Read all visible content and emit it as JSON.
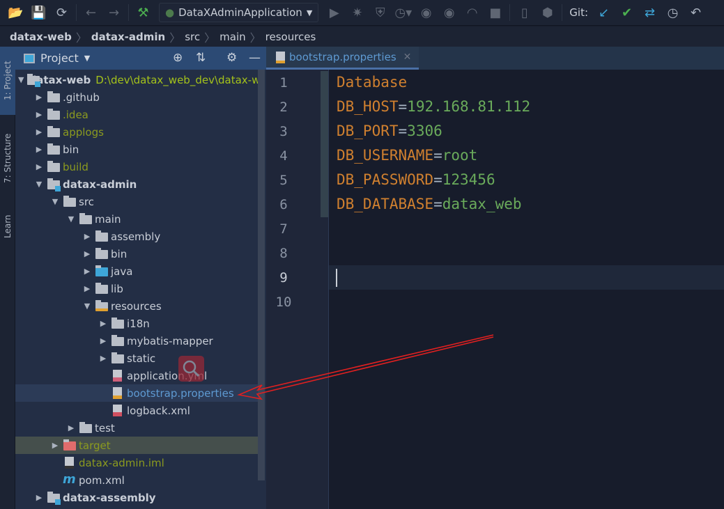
{
  "toolbar": {
    "run_config": "DataXAdminApplication",
    "git_label": "Git:",
    "icons": [
      "open-folder",
      "save",
      "sync",
      "back",
      "forward",
      "build-hammer",
      "run",
      "debug",
      "coverage",
      "profile",
      "attach",
      "attach-debug",
      "profiler",
      "stop",
      "device",
      "sdk",
      "git-update",
      "git-commit",
      "git-merge",
      "git-history",
      "rollback"
    ],
    "colors": {
      "hammer": "#4caf50",
      "git_update": "#3ea6d8",
      "git_commit": "#4caf50"
    }
  },
  "breadcrumb": [
    "datax-web",
    "datax-admin",
    "src",
    "main",
    "resources"
  ],
  "side_tabs": {
    "project": "1: Project",
    "structure": "7: Structure",
    "learn": "Learn"
  },
  "project_panel": {
    "title": "Project",
    "tree": [
      {
        "label": "datax-web",
        "path": "D:\\dev\\datax_web_dev\\datax-w",
        "level": 0,
        "open": true,
        "type": "module",
        "bold": true
      },
      {
        "label": ".github",
        "level": 1,
        "open": false,
        "type": "folder"
      },
      {
        "label": ".idea",
        "level": 1,
        "open": false,
        "type": "folder",
        "color": "#8b9a1f"
      },
      {
        "label": "applogs",
        "level": 1,
        "open": false,
        "type": "folder",
        "color": "#8b9a1f"
      },
      {
        "label": "bin",
        "level": 1,
        "open": false,
        "type": "folder"
      },
      {
        "label": "build",
        "level": 1,
        "open": false,
        "type": "folder",
        "color": "#8b9a1f"
      },
      {
        "label": "datax-admin",
        "level": 1,
        "open": true,
        "type": "module",
        "bold": true
      },
      {
        "label": "src",
        "level": 2,
        "open": true,
        "type": "folder"
      },
      {
        "label": "main",
        "level": 3,
        "open": true,
        "type": "folder"
      },
      {
        "label": "assembly",
        "level": 4,
        "open": false,
        "type": "folder"
      },
      {
        "label": "bin",
        "level": 4,
        "open": false,
        "type": "folder"
      },
      {
        "label": "java",
        "level": 4,
        "open": false,
        "type": "source-folder"
      },
      {
        "label": "lib",
        "level": 4,
        "open": false,
        "type": "folder"
      },
      {
        "label": "resources",
        "level": 4,
        "open": true,
        "type": "resources-folder"
      },
      {
        "label": "i18n",
        "level": 5,
        "open": false,
        "type": "folder"
      },
      {
        "label": "mybatis-mapper",
        "level": 5,
        "open": false,
        "type": "folder"
      },
      {
        "label": "static",
        "level": 5,
        "open": false,
        "type": "folder"
      },
      {
        "label": "application.yml",
        "level": 5,
        "type": "yml-file"
      },
      {
        "label": "bootstrap.properties",
        "level": 5,
        "type": "properties-file",
        "selected": true,
        "color": "#5e9ad2"
      },
      {
        "label": "logback.xml",
        "level": 5,
        "type": "xml-file"
      },
      {
        "label": "test",
        "level": 3,
        "open": false,
        "type": "folder"
      },
      {
        "label": "target",
        "level": 2,
        "open": false,
        "type": "excluded-folder",
        "color": "#8b9a1f",
        "highlighted": true
      },
      {
        "label": "datax-admin.iml",
        "level": 2,
        "type": "iml-file",
        "color": "#8b9a1f"
      },
      {
        "label": "pom.xml",
        "level": 2,
        "type": "maven-file"
      },
      {
        "label": "datax-assembly",
        "level": 1,
        "open": false,
        "type": "module",
        "bold": true
      }
    ]
  },
  "editor": {
    "tab": "bootstrap.properties",
    "current_line": 9,
    "line_numbers": [
      "1",
      "2",
      "3",
      "4",
      "5",
      "6",
      "7",
      "8",
      "9",
      "10"
    ],
    "lines": [
      {
        "key": "Database",
        "eq": "",
        "value": ""
      },
      {
        "key": "DB_HOST",
        "eq": "=",
        "value": "192.168.81.112"
      },
      {
        "key": "DB_PORT",
        "eq": "=",
        "value": "3306"
      },
      {
        "key": "DB_USERNAME",
        "eq": "=",
        "value": "root"
      },
      {
        "key": "DB_PASSWORD",
        "eq": "=",
        "value": "123456"
      },
      {
        "key": "DB_DATABASE",
        "eq": "=",
        "value": "datax_web"
      }
    ]
  },
  "annotation": {
    "arrow_color": "#e02020"
  }
}
